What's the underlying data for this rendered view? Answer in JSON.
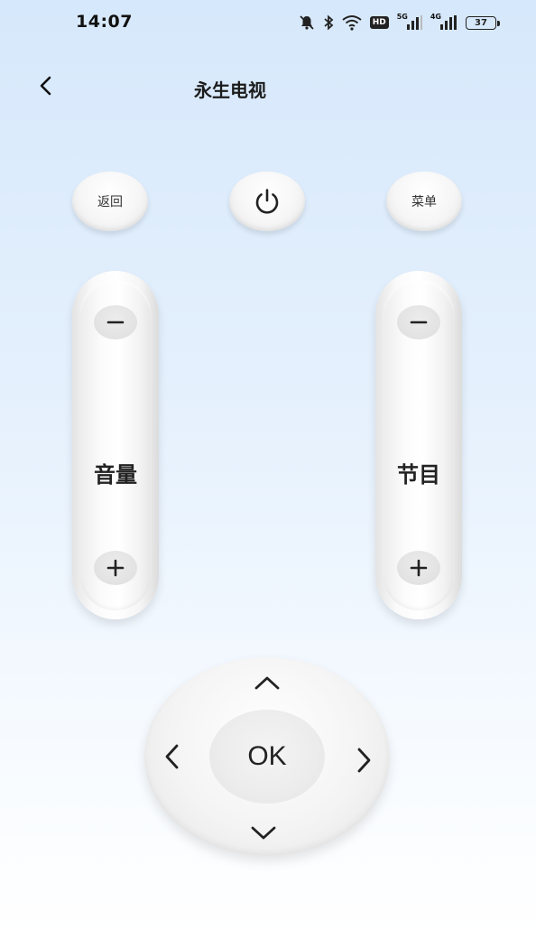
{
  "status_bar": {
    "time": "14:07",
    "hd_label": "HD",
    "signal_1_label": "5G",
    "signal_2_label": "4G",
    "battery": "37"
  },
  "header": {
    "title": "永生电视"
  },
  "buttons": {
    "back_label": "返回",
    "menu_label": "菜单"
  },
  "volume": {
    "label": "音量"
  },
  "channel": {
    "label": "节目"
  },
  "dpad": {
    "ok_label": "OK"
  }
}
